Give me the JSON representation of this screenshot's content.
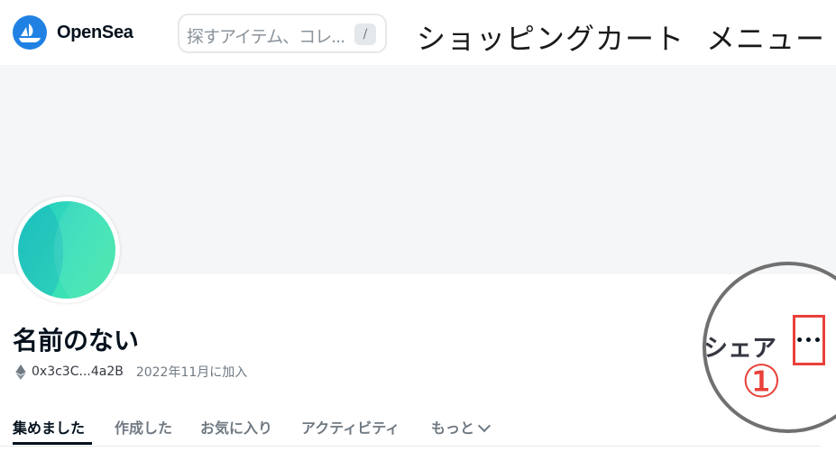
{
  "header": {
    "brand": "OpenSea",
    "search_placeholder": "探すアイテム、コレ...",
    "search_shortcut": "/",
    "cart_label": "ショッピングカート",
    "menu_label": "メニュー"
  },
  "profile": {
    "name": "名前のない",
    "address": "0x3c3C...4a2B",
    "joined": "2022年11月に加入",
    "share_label": "シェア",
    "more_label": "•••"
  },
  "annotation": {
    "marker": "①",
    "color": "#e8413a"
  },
  "tabs": [
    {
      "label": "集めました",
      "active": true
    },
    {
      "label": "作成した",
      "active": false
    },
    {
      "label": "お気に入り",
      "active": false
    },
    {
      "label": "アクティビティ",
      "active": false
    },
    {
      "label": "もっと",
      "active": false
    }
  ],
  "colors": {
    "brand": "#2081e2",
    "banner": "#f5f6f8",
    "avatar_gradient": [
      "#20c9c1",
      "#42e6a4"
    ]
  },
  "icons": [
    "opensea-logo-icon",
    "ethereum-icon",
    "chevron-down-icon",
    "more-options-icon"
  ]
}
